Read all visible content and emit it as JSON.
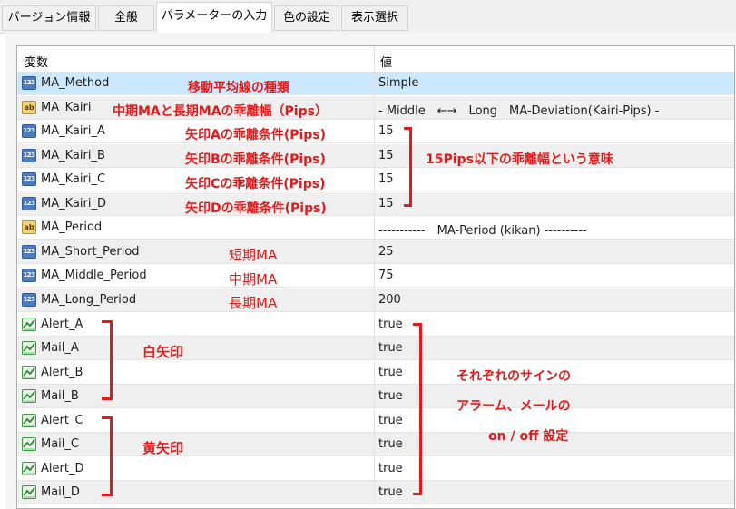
{
  "tabs": [
    {
      "label": "バージョン情報"
    },
    {
      "label": "全般"
    },
    {
      "label": "パラメーターの入力",
      "active": true
    },
    {
      "label": "色の設定"
    },
    {
      "label": "表示選択"
    }
  ],
  "table": {
    "header_variable": "変数",
    "header_value": "値",
    "rows": [
      {
        "icon": "number-icon",
        "icon_text": "123",
        "name": "MA_Method",
        "value": "Simple"
      },
      {
        "icon": "string-icon",
        "icon_text": "ab",
        "name": "MA_Kairi",
        "value": "- Middle　←→　Long　MA-Deviation(Kairi-Pips) -"
      },
      {
        "icon": "number-icon",
        "icon_text": "123",
        "name": "MA_Kairi_A",
        "value": "15"
      },
      {
        "icon": "number-icon",
        "icon_text": "123",
        "name": "MA_Kairi_B",
        "value": "15"
      },
      {
        "icon": "number-icon",
        "icon_text": "123",
        "name": "MA_Kairi_C",
        "value": "15"
      },
      {
        "icon": "number-icon",
        "icon_text": "123",
        "name": "MA_Kairi_D",
        "value": "15"
      },
      {
        "icon": "string-icon",
        "icon_text": "ab",
        "name": "MA_Period",
        "value": "-----------　MA-Period (kikan) ----------"
      },
      {
        "icon": "number-icon",
        "icon_text": "123",
        "name": "MA_Short_Period",
        "value": "25"
      },
      {
        "icon": "number-icon",
        "icon_text": "123",
        "name": "MA_Middle_Period",
        "value": "75"
      },
      {
        "icon": "number-icon",
        "icon_text": "123",
        "name": "MA_Long_Period",
        "value": "200"
      },
      {
        "icon": "bool-icon",
        "icon_text": "",
        "name": "Alert_A",
        "value": "true"
      },
      {
        "icon": "bool-icon",
        "icon_text": "",
        "name": "Mail_A",
        "value": "true"
      },
      {
        "icon": "bool-icon",
        "icon_text": "",
        "name": "Alert_B",
        "value": "true"
      },
      {
        "icon": "bool-icon",
        "icon_text": "",
        "name": "Mail_B",
        "value": "true"
      },
      {
        "icon": "bool-icon",
        "icon_text": "",
        "name": "Alert_C",
        "value": "true"
      },
      {
        "icon": "bool-icon",
        "icon_text": "",
        "name": "Mail_C",
        "value": "true"
      },
      {
        "icon": "bool-icon",
        "icon_text": "",
        "name": "Alert_D",
        "value": "true"
      },
      {
        "icon": "bool-icon",
        "icon_text": "",
        "name": "Mail_D",
        "value": "true"
      }
    ]
  },
  "annotations": {
    "ma_method": "移動平均線の種類",
    "ma_kairi": "中期MAと長期MAの乖離幅（Pips）",
    "kairi_a": "矢印Aの乖離条件(Pips)",
    "kairi_b": "矢印Bの乖離条件(Pips)",
    "kairi_c": "矢印Cの乖離条件(Pips)",
    "kairi_d": "矢印Dの乖離条件(Pips)",
    "kairi_meaning": "15Pips以下の乖離幅という意味",
    "short": "短期MA",
    "middle": "中期MA",
    "long": "長期MA",
    "white_arrow": "白矢印",
    "yellow_arrow": "黄矢印",
    "signal_line1": "それぞれのサインの",
    "signal_line2": "アラーム、メールの",
    "signal_line3": "on / off 設定"
  },
  "colors": {
    "annotation_red": "#e11b1b",
    "selected_row": "#cce8ff"
  }
}
